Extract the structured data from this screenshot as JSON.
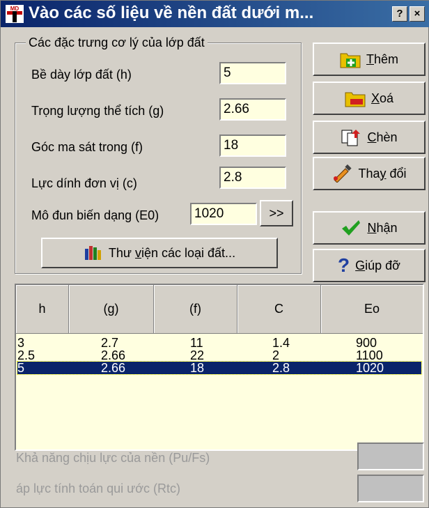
{
  "window": {
    "title": "Vào các số liệu về nền đất dưới m...",
    "help_glyph": "?",
    "close_glyph": "×",
    "app_icon_text": "MD"
  },
  "group": {
    "legend": "Các đặc trưng cơ lý của lớp đất",
    "fields": [
      {
        "label": "Bề dày lớp đất (h)",
        "value": "5"
      },
      {
        "label": "Trọng lượng thể tích (g)",
        "value": "2.66"
      },
      {
        "label": "Góc ma sát trong (f)",
        "value": "18"
      },
      {
        "label": "Lực dính đơn vị (c)",
        "value": "2.8"
      },
      {
        "label": "Mô đun biến dạng (E0)",
        "value": "1020"
      }
    ],
    "more_button": ">>",
    "library_button": {
      "pre": "Thư ",
      "u": "v",
      "post": "iện các loại đất..."
    }
  },
  "buttons": {
    "them": {
      "u": "T",
      "post": "hêm"
    },
    "xoa": {
      "u": "X",
      "post": "oá"
    },
    "chen": {
      "u": "C",
      "post": "hèn"
    },
    "thaydoi": {
      "pre": "Tha",
      "u": "y",
      "post": " đổi"
    },
    "nhan": {
      "u": "N",
      "post": "hận"
    },
    "giupdo": {
      "u": "G",
      "post": "iúp đỡ"
    }
  },
  "table": {
    "headers": [
      "h",
      "(g)",
      "(f)",
      "C",
      "Eo"
    ],
    "rows": [
      [
        "3",
        "2.7",
        "11",
        "1.4",
        "900"
      ],
      [
        "2.5",
        "2.66",
        "22",
        "2",
        "1100"
      ],
      [
        "5",
        "2.66",
        "18",
        "2.8",
        "1020"
      ]
    ],
    "selected_row": 2
  },
  "results": {
    "capacity_label": "Khả năng chịu lực của nền (Pu/Fs)",
    "pressure_label": "áp lực tính toán qui ước (Rtc)"
  },
  "colors": {
    "title_bg": "#0a246a",
    "field_bg": "#ffffe0",
    "selection_bg": "#0a246a",
    "face": "#d4d0c8"
  }
}
